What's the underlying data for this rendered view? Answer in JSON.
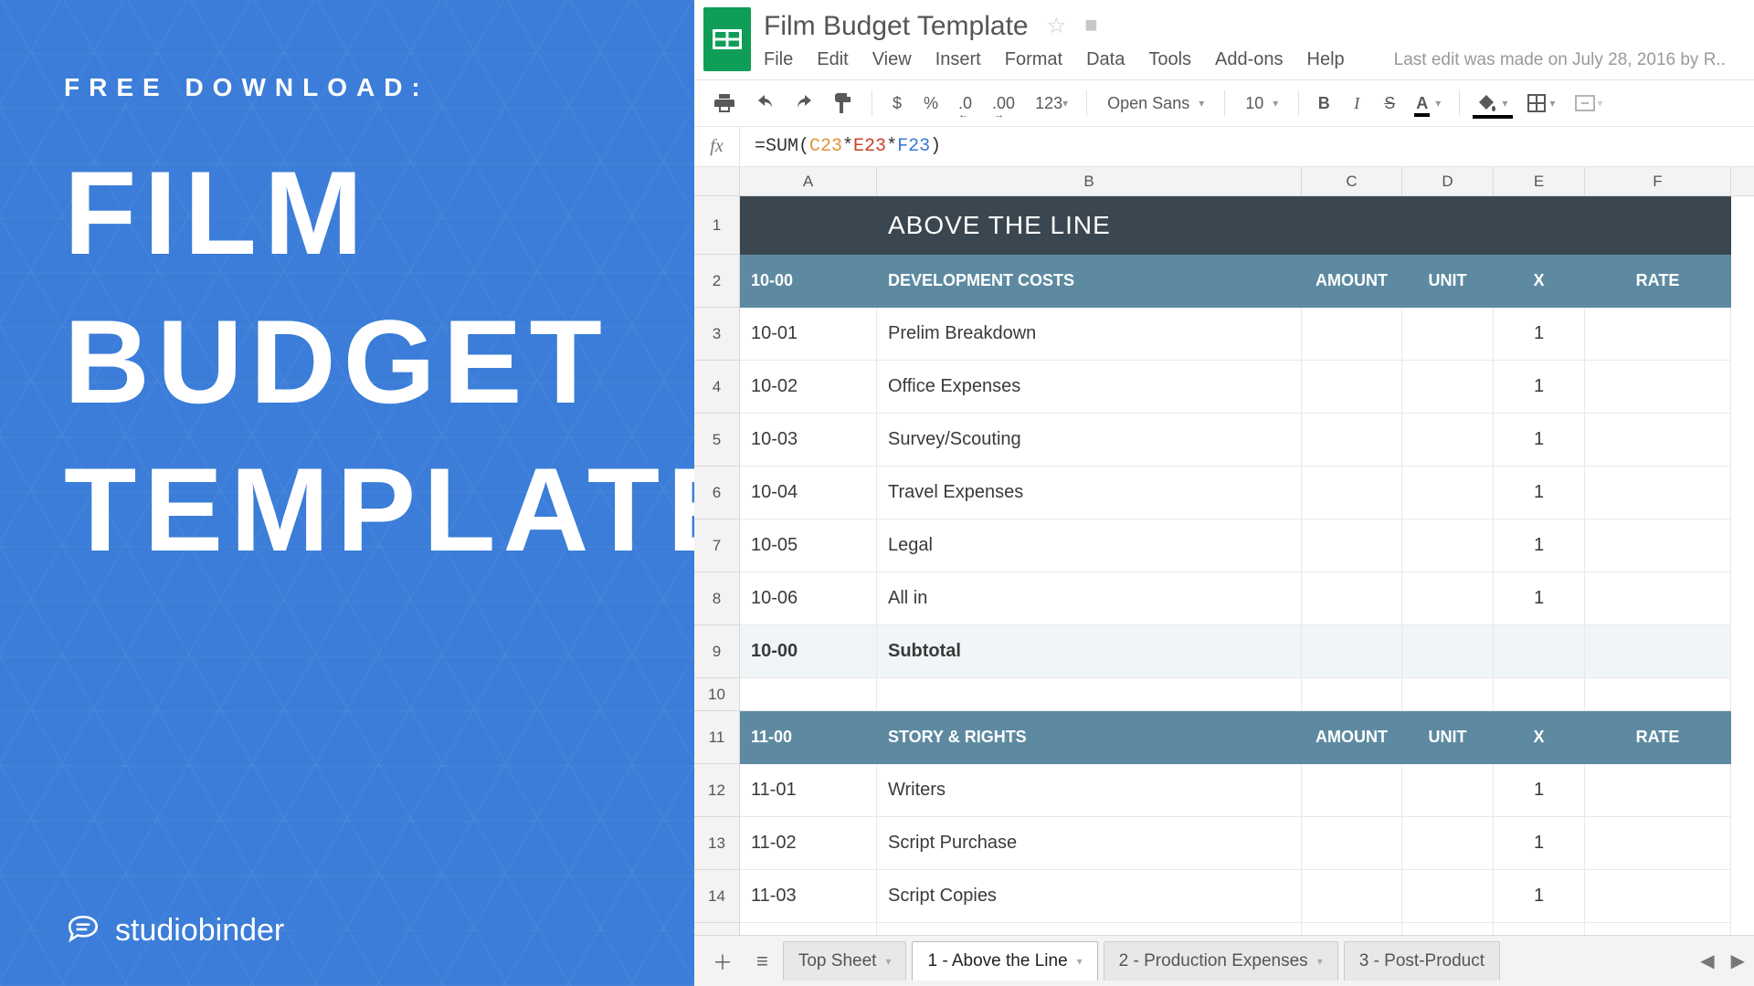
{
  "promo": {
    "eyebrow": "FREE DOWNLOAD:",
    "line1": "FILM",
    "line2": "BUDGET",
    "line3": "TEMPLATE",
    "brand_a": "studio",
    "brand_b": "binder"
  },
  "doc": {
    "title": "Film Budget Template",
    "edit_status": "Last edit was made on July 28, 2016 by R.."
  },
  "menu": {
    "file": "File",
    "edit": "Edit",
    "view": "View",
    "insert": "Insert",
    "format": "Format",
    "data": "Data",
    "tools": "Tools",
    "addons": "Add-ons",
    "help": "Help"
  },
  "toolbar": {
    "dollar": "$",
    "percent": "%",
    "dec_dec": ".0",
    "inc_dec": ".00",
    "numfmt": "123",
    "font": "Open Sans",
    "size": "10",
    "bold": "B",
    "italic": "I",
    "strike": "S",
    "textcolor": "A"
  },
  "formula": {
    "fx": "fx",
    "raw": "=SUM(C23*E23*F23)",
    "prefix": "=SUM(",
    "r1": "C23",
    "s1": "*",
    "r2": "E23",
    "s2": "*",
    "r3": "F23",
    "suffix": ")"
  },
  "columns": {
    "A": "A",
    "B": "B",
    "C": "C",
    "D": "D",
    "E": "E",
    "F": "F"
  },
  "sheet": {
    "section_title": "ABOVE THE LINE",
    "hdr": {
      "amount": "AMOUNT",
      "unit": "UNIT",
      "x": "X",
      "rate": "RATE"
    },
    "g1": {
      "code": "10-00",
      "title": "DEVELOPMENT COSTS"
    },
    "r3": {
      "n": "3",
      "code": "10-01",
      "desc": "Prelim Breakdown",
      "x": "1"
    },
    "r4": {
      "n": "4",
      "code": "10-02",
      "desc": "Office Expenses",
      "x": "1"
    },
    "r5": {
      "n": "5",
      "code": "10-03",
      "desc": "Survey/Scouting",
      "x": "1"
    },
    "r6": {
      "n": "6",
      "code": "10-04",
      "desc": "Travel Expenses",
      "x": "1"
    },
    "r7": {
      "n": "7",
      "code": "10-05",
      "desc": "Legal",
      "x": "1"
    },
    "r8": {
      "n": "8",
      "code": "10-06",
      "desc": "All in",
      "x": "1"
    },
    "r9": {
      "n": "9",
      "code": "10-00",
      "desc": "Subtotal"
    },
    "r10": {
      "n": "10"
    },
    "g2": {
      "code": "11-00",
      "title": "STORY & RIGHTS"
    },
    "r12": {
      "n": "12",
      "code": "11-01",
      "desc": "Writers",
      "x": "1"
    },
    "r13": {
      "n": "13",
      "code": "11-02",
      "desc": "Script Purchase",
      "x": "1"
    },
    "r14": {
      "n": "14",
      "code": "11-03",
      "desc": "Script Copies",
      "x": "1"
    }
  },
  "tabs": {
    "t1": "Top Sheet",
    "t2": "1 - Above the Line",
    "t3": "2 - Production Expenses",
    "t4": "3 - Post-Product"
  }
}
